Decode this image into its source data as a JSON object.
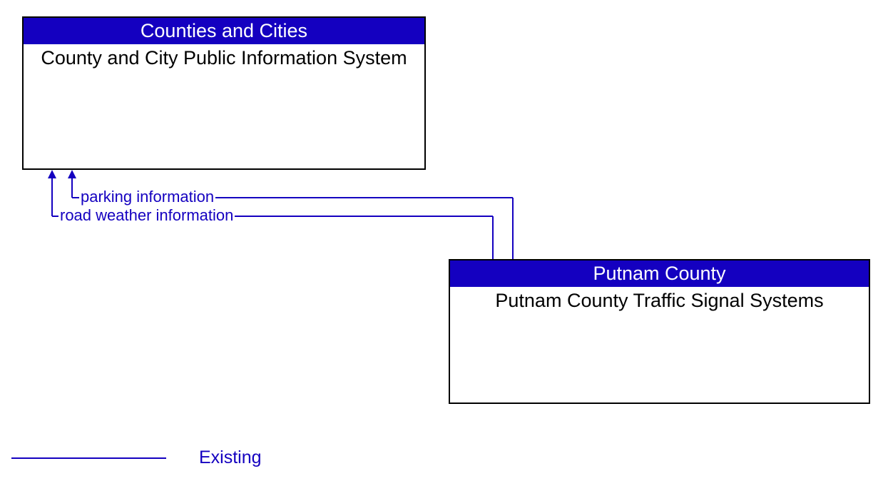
{
  "boxes": {
    "top": {
      "header": "Counties and Cities",
      "body": "County and City Public Information System"
    },
    "bottom": {
      "header": "Putnam County",
      "body": "Putnam County Traffic Signal Systems"
    }
  },
  "flows": {
    "flow1": "parking information",
    "flow2": "road weather information"
  },
  "legend": {
    "existing": "Existing"
  },
  "colors": {
    "header_bg": "#1400c0",
    "line": "#1400c0"
  }
}
